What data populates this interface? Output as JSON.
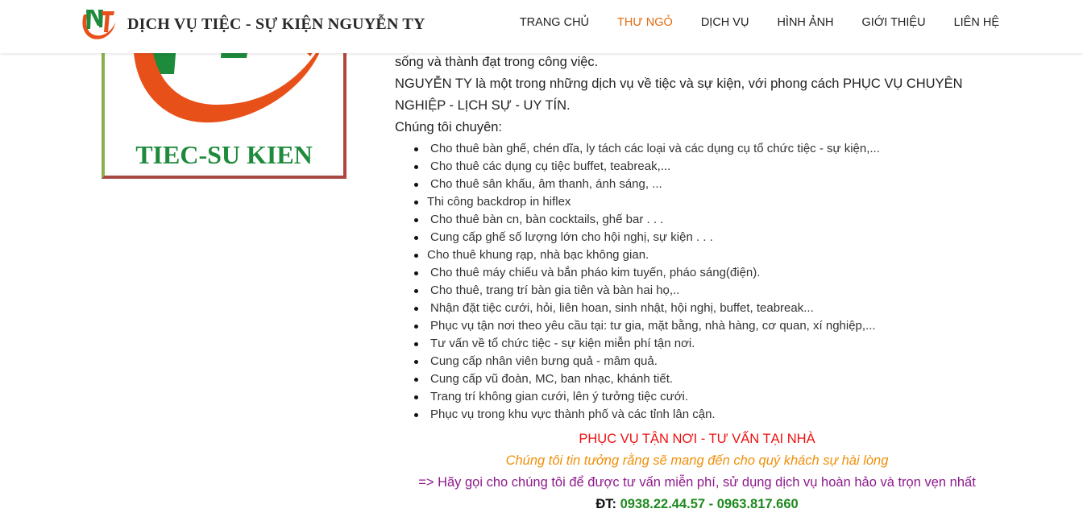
{
  "header": {
    "brand_name": "DỊCH VỤ TIỆC - SỰ KIỆN NGUYỄN TY",
    "logo_letters": "NT",
    "nav": [
      {
        "label": "TRANG CHỦ",
        "active": false
      },
      {
        "label": "THƯ NGỎ",
        "active": true
      },
      {
        "label": "DỊCH VỤ",
        "active": false
      },
      {
        "label": "HÌNH ẢNH",
        "active": false
      },
      {
        "label": "GIỚI THIỆU",
        "active": false
      },
      {
        "label": "LIÊN HỆ",
        "active": false
      }
    ]
  },
  "logo_image": {
    "text": "TIEC-SU KIEN"
  },
  "content": {
    "para_tail": "sống và thành đạt trong công việc.",
    "para_intro": "NGUYỄN TY là một trong những dịch vụ về tiệc và sự kiện, với phong cách PHỤC VỤ CHUYÊN NGHIỆP - LỊCH SỰ - UY TÍN.",
    "specialty_heading": "Chúng tôi chuyên:",
    "services": [
      "Cho thuê bàn ghế, chén dĩa, ly tách các loại và các dụng cụ tổ chức tiệc - sự kiện,...",
      "Cho thuê các dụng cụ tiệc buffet, teabreak,...",
      "Cho thuê sân khấu, âm thanh, ánh sáng, ...",
      "Thi công backdrop in hiflex",
      "Cho thuê bàn cn, bàn cocktails, ghế bar . . .",
      "Cung cấp ghế số lượng lớn cho hội nghị, sự kiện . . .",
      "Cho thuê  khung rạp, nhà bạc không gian.",
      "Cho thuê máy chiếu và bắn pháo kim tuyến, pháo sáng(điện).",
      "Cho thuê, trang trí bàn gia tiên và bàn hai họ,..",
      "Nhận đặt tiệc cưới, hỏi, liên hoan, sinh nhật, hội nghị, buffet, teabreak...",
      "Phục vụ tận nơi theo yêu cầu tại: tư gia, mặt bằng, nhà hàng, cơ quan, xí nghiệp,...",
      "Tư vấn về tổ chức tiệc - sự kiện miễn phí tận nơi.",
      "Cung cấp nhân viên bưng quả - mâm quả.",
      "Cung cấp vũ đoàn, MC, ban nhạc, khánh tiết.",
      "Trang trí không gian cưới, lên ý tưởng tiệc cưới.",
      "Phục vụ trong khu vực thành phố và các tỉnh lân cận."
    ],
    "headline_red": "PHỤC VỤ TẬN NƠI - TƯ VẤN TẠI NHÀ",
    "headline_orange": "Chúng tôi tin tưởng rằng sẽ mang đến cho quý khách sự hài lòng",
    "headline_purple": "=> Hãy gọi cho chúng tôi để được tư vấn miễn phí, sử dụng dịch vụ hoàn hảo và trọn vẹn nhất",
    "phone_label": "ĐT: ",
    "phone_numbers": "0938.22.44.57 - 0963.817.660"
  },
  "colors": {
    "nav_active": "#e36b10",
    "brand_orange": "#e8501a",
    "brand_green": "#1d8a3c",
    "red_text": "#ee1111",
    "orange_text": "#f0900a",
    "purple_text": "#8e1a8c",
    "green_phone": "#1f8a1f"
  }
}
